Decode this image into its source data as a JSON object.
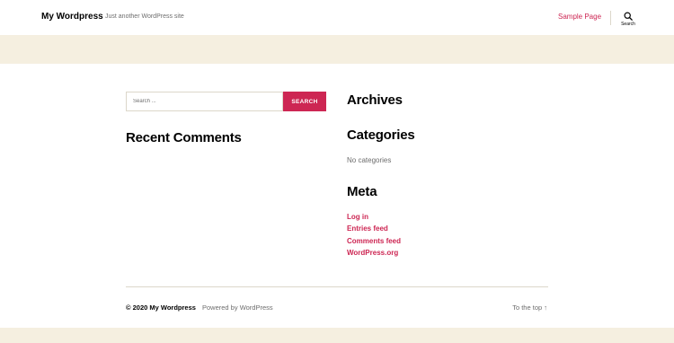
{
  "header": {
    "site_title": "My Wordpress",
    "site_description": "Just another WordPress site",
    "nav": [
      "Sample Page"
    ],
    "search_toggle_label": "Search"
  },
  "search_widget": {
    "placeholder": "Search ...",
    "button_label": "SEARCH"
  },
  "widgets": {
    "recent_comments_title": "Recent Comments",
    "archives_title": "Archives",
    "categories_title": "Categories",
    "categories_empty": "No categories",
    "meta_title": "Meta",
    "meta_links": [
      "Log in",
      "Entries feed",
      "Comments feed",
      "WordPress.org"
    ]
  },
  "footer": {
    "copyright": "© 2020 My Wordpress",
    "powered_by": "Powered by WordPress",
    "to_top": "To the top ↑"
  },
  "colors": {
    "accent": "#cd2653",
    "band": "#f5efe0",
    "muted_text": "#6d6d6d",
    "border": "#dcd7ca"
  },
  "icons": {
    "search_toggle": "search-icon"
  }
}
